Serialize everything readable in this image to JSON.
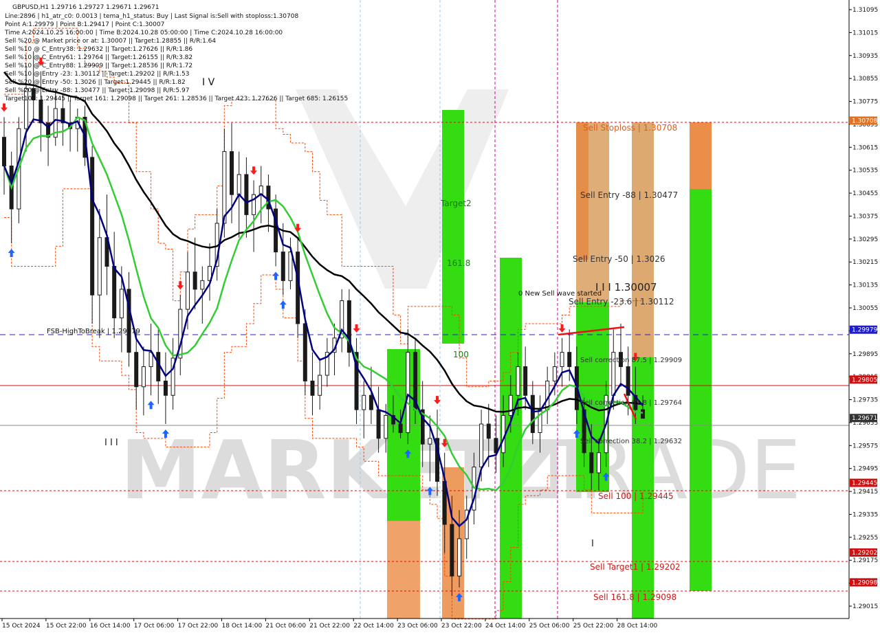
{
  "colors": {
    "background": "#ffffff",
    "candle": "#1a1a1a",
    "ema_slow": "#000000",
    "ema_mid": "#000080",
    "ema_fast": "#33cc33",
    "band": "#ff4400",
    "buy_arrow": "#1e64ff",
    "sell_arrow": "#ff1a1a",
    "zone_green": "#33dd11",
    "zone_lightgreen": "#66e63a",
    "zone_orange": "#e87a2a",
    "zone_tan": "#d9a060",
    "line_red": "#d01010",
    "line_blue": "#1e1ecc",
    "line_gray": "#888888",
    "axis_text": "#111111",
    "watermark": "#d9d9d9"
  },
  "header": {
    "symbol_line": "GBPUSD,H1  1.29716 1.29727 1.29671 1.29671",
    "info_lines": [
      "Line:2896 | h1_atr_c0: 0.0013 | tema_h1_status: Buy | Last Signal is:Sell with stoploss:1.30708",
      "Point A:1.29979 | Point B:1.29417 | Point C:1.30007",
      "Time A:2024.10.25 16:00:00 | Time B:2024.10.28 05:00:00 | Time C:2024.10.28 16:00:00",
      "Sell %20 @ Market price or at: 1.30007 || Target:1.28855 || R/R:1.64",
      "Sell %10 @ C_Entry38: 1.29632 || Target:1.27626 || R/R:1.86",
      "Sell %10 @ C_Entry61: 1.29764 || Target:1.26155 || R/R:3.82",
      "Sell %10 @ C_Entry88: 1.29909 || Target:1.28536 || R/R:1.72",
      "Sell %10 @ Entry -23: 1.30112 || Target:1.29202 || R/R:1.53",
      "Sell %20 @ Entry -50: 1.3026 || Target:1.29445 || R/R:1.82",
      "Sell %20 @ Entry -88: 1.30477 || Target:1.29098 || R/R:5.97",
      "Target100: 1.29445 || Target 161: 1.29098 || Target 261: 1.28536 || Target 423: 1.27626 || Target 685: 1.26155"
    ],
    "wave_label": "I V"
  },
  "watermark": {
    "left": "MARKETZI",
    "right": "TRADE"
  },
  "annotations": {
    "fsb": "FSB-HighToBreak | 1.29979",
    "sell_stoploss": "Sell Stoploss | 1.30708",
    "sell_entry_88": "Sell Entry -88 | 1.30477",
    "sell_entry_50": "Sell Entry -50 | 1.3026",
    "point_c": "I I I 1.30007",
    "new_wave": "0 New Sell wave started",
    "sell_entry_23": "Sell Entry -23.6 | 1.30112",
    "sell_corr_875": "Sell correction 87.5 | 1.29909",
    "sell_corr_618": "Sell correction 61.8 | 1.29764",
    "sell_corr_382": "Sell correction 38.2 | 1.29632",
    "sell_100": "Sell 100 | 1.29445",
    "sell_target1": "Sell Target1 | 1.29202",
    "sell_1618": "Sell 161.8 | 1.29098",
    "target2": "Target2",
    "z1618": "161.8",
    "z100": "100",
    "wave_iii_left": "I I I",
    "wave_i": "I"
  },
  "chart_data": {
    "type": "candlestick",
    "symbol": "GBPUSD",
    "timeframe": "H1",
    "ylim": [
      1.29015,
      1.31115
    ],
    "y_ticks": [
      "1.31095",
      "1.31015",
      "1.30935",
      "1.30855",
      "1.30775",
      "1.30695",
      "1.30615",
      "1.30535",
      "1.30455",
      "1.30375",
      "1.30295",
      "1.30215",
      "1.30135",
      "1.30055",
      "1.29975",
      "1.29895",
      "1.29815",
      "1.29735",
      "1.29655",
      "1.29575",
      "1.29495",
      "1.29415",
      "1.29335",
      "1.29255",
      "1.29175",
      "1.29095",
      "1.29015"
    ],
    "x_labels": [
      "15 Oct 2024",
      "15 Oct 22:00",
      "16 Oct 14:00",
      "17 Oct 06:00",
      "17 Oct 22:00",
      "18 Oct 14:00",
      "21 Oct 06:00",
      "21 Oct 22:00",
      "22 Oct 14:00",
      "23 Oct 06:00",
      "23 Oct 22:00",
      "24 Oct 14:00",
      "25 Oct 06:00",
      "25 Oct 22:00",
      "28 Oct 14:00"
    ],
    "price_tags": [
      {
        "value": "1.30708",
        "kind": "stoploss"
      },
      {
        "value": "1.29979",
        "kind": "fsb"
      },
      {
        "value": "1.29805",
        "kind": "red_line"
      },
      {
        "value": "1.29671",
        "kind": "current"
      },
      {
        "value": "1.29445",
        "kind": "target100"
      },
      {
        "value": "1.29202",
        "kind": "target1"
      },
      {
        "value": "1.29098",
        "kind": "target161"
      }
    ],
    "candles": [
      [
        1.3065,
        1.3072,
        1.3045,
        1.3055
      ],
      [
        1.3055,
        1.306,
        1.3028,
        1.304
      ],
      [
        1.304,
        1.3072,
        1.3035,
        1.3068
      ],
      [
        1.3068,
        1.309,
        1.306,
        1.3082
      ],
      [
        1.3082,
        1.3095,
        1.307,
        1.3078
      ],
      [
        1.3078,
        1.3088,
        1.306,
        1.307
      ],
      [
        1.307,
        1.3076,
        1.3055,
        1.3065
      ],
      [
        1.3065,
        1.3082,
        1.3062,
        1.3075
      ],
      [
        1.3075,
        1.308,
        1.3062,
        1.307
      ],
      [
        1.307,
        1.3078,
        1.306,
        1.3068
      ],
      [
        1.3068,
        1.3075,
        1.306,
        1.3072
      ],
      [
        1.3072,
        1.3076,
        1.3055,
        1.3058
      ],
      [
        1.3058,
        1.3062,
        1.3,
        1.301
      ],
      [
        1.301,
        1.304,
        1.2995,
        1.303
      ],
      [
        1.303,
        1.3045,
        1.301,
        1.302
      ],
      [
        1.302,
        1.3032,
        1.2995,
        1.3002
      ],
      [
        1.3002,
        1.302,
        1.299,
        1.3012
      ],
      [
        1.3012,
        1.3018,
        1.2985,
        1.299
      ],
      [
        1.299,
        1.2998,
        1.297,
        1.2978
      ],
      [
        1.2978,
        1.2992,
        1.2968,
        1.2985
      ],
      [
        1.2985,
        1.3,
        1.2975,
        1.299
      ],
      [
        1.299,
        1.2998,
        1.2972,
        1.298
      ],
      [
        1.298,
        1.299,
        1.2965,
        1.2975
      ],
      [
        1.2975,
        1.2995,
        1.297,
        1.2988
      ],
      [
        1.2988,
        1.301,
        1.2982,
        1.3005
      ],
      [
        1.3005,
        1.3025,
        1.2998,
        1.3018
      ],
      [
        1.3018,
        1.303,
        1.3005,
        1.3012
      ],
      [
        1.3012,
        1.302,
        1.3,
        1.3015
      ],
      [
        1.3015,
        1.3028,
        1.3008,
        1.302
      ],
      [
        1.302,
        1.304,
        1.3015,
        1.3035
      ],
      [
        1.3035,
        1.3068,
        1.303,
        1.306
      ],
      [
        1.306,
        1.307,
        1.3035,
        1.3045
      ],
      [
        1.3045,
        1.306,
        1.303,
        1.3052
      ],
      [
        1.3052,
        1.3058,
        1.303,
        1.3038
      ],
      [
        1.3038,
        1.305,
        1.3025,
        1.3045
      ],
      [
        1.3045,
        1.3055,
        1.3035,
        1.3048
      ],
      [
        1.3048,
        1.3052,
        1.3032,
        1.304
      ],
      [
        1.304,
        1.3045,
        1.302,
        1.3025
      ],
      [
        1.3025,
        1.3035,
        1.301,
        1.3015
      ],
      [
        1.3015,
        1.303,
        1.3012,
        1.3025
      ],
      [
        1.3025,
        1.303,
        1.2995,
        1.3
      ],
      [
        1.3,
        1.3005,
        1.2975,
        1.298
      ],
      [
        1.298,
        1.299,
        1.2968,
        1.2975
      ],
      [
        1.2975,
        1.2988,
        1.297,
        1.2982
      ],
      [
        1.2982,
        1.2995,
        1.2978,
        1.299
      ],
      [
        1.299,
        1.3,
        1.2982,
        1.2995
      ],
      [
        1.2995,
        1.3012,
        1.299,
        1.3008
      ],
      [
        1.3008,
        1.3012,
        1.2985,
        1.299
      ],
      [
        1.299,
        1.2995,
        1.2965,
        1.297
      ],
      [
        1.297,
        1.298,
        1.296,
        1.2975
      ],
      [
        1.2975,
        1.2985,
        1.2965,
        1.297
      ],
      [
        1.297,
        1.2978,
        1.2955,
        1.296
      ],
      [
        1.296,
        1.2972,
        1.2955,
        1.2968
      ],
      [
        1.2968,
        1.2975,
        1.2962,
        1.2965
      ],
      [
        1.2965,
        1.297,
        1.296,
        1.2962
      ],
      [
        1.2962,
        1.2998,
        1.2958,
        1.299
      ],
      [
        1.299,
        1.2995,
        1.2965,
        1.297
      ],
      [
        1.297,
        1.298,
        1.295,
        1.2958
      ],
      [
        1.2958,
        1.2968,
        1.2945,
        1.296
      ],
      [
        1.296,
        1.297,
        1.294,
        1.2945
      ],
      [
        1.2945,
        1.2955,
        1.292,
        1.293
      ],
      [
        1.293,
        1.294,
        1.2905,
        1.2912
      ],
      [
        1.2912,
        1.2935,
        1.2908,
        1.2925
      ],
      [
        1.2925,
        1.294,
        1.2918,
        1.2935
      ],
      [
        1.2935,
        1.2955,
        1.293,
        1.295
      ],
      [
        1.295,
        1.297,
        1.2945,
        1.2965
      ],
      [
        1.2965,
        1.2972,
        1.295,
        1.296
      ],
      [
        1.296,
        1.2968,
        1.2948,
        1.2955
      ],
      [
        1.2955,
        1.2975,
        1.295,
        1.2968
      ],
      [
        1.2968,
        1.2982,
        1.2962,
        1.2975
      ],
      [
        1.2975,
        1.299,
        1.2968,
        1.2985
      ],
      [
        1.2985,
        1.2992,
        1.297,
        1.2975
      ],
      [
        1.2975,
        1.298,
        1.2958,
        1.2962
      ],
      [
        1.2962,
        1.2975,
        1.2955,
        1.297
      ],
      [
        1.297,
        1.2985,
        1.2965,
        1.298
      ],
      [
        1.298,
        1.299,
        1.2975,
        1.2985
      ],
      [
        1.2985,
        1.2995,
        1.2978,
        1.299
      ],
      [
        1.299,
        1.2998,
        1.298,
        1.2985
      ],
      [
        1.2985,
        1.2992,
        1.2965,
        1.297
      ],
      [
        1.297,
        1.2975,
        1.295,
        1.2955
      ],
      [
        1.2955,
        1.2965,
        1.2942,
        1.2948
      ],
      [
        1.2948,
        1.296,
        1.2942,
        1.2955
      ],
      [
        1.2955,
        1.298,
        1.295,
        1.2975
      ],
      [
        1.2975,
        1.2998,
        1.297,
        1.299
      ],
      [
        1.299,
        1.3,
        1.2978,
        1.2985
      ],
      [
        1.2985,
        1.2992,
        1.2968,
        1.2975
      ],
      [
        1.2975,
        1.2985,
        1.2965,
        1.297
      ],
      [
        1.297,
        1.2975,
        1.2967,
        1.2967
      ]
    ]
  }
}
